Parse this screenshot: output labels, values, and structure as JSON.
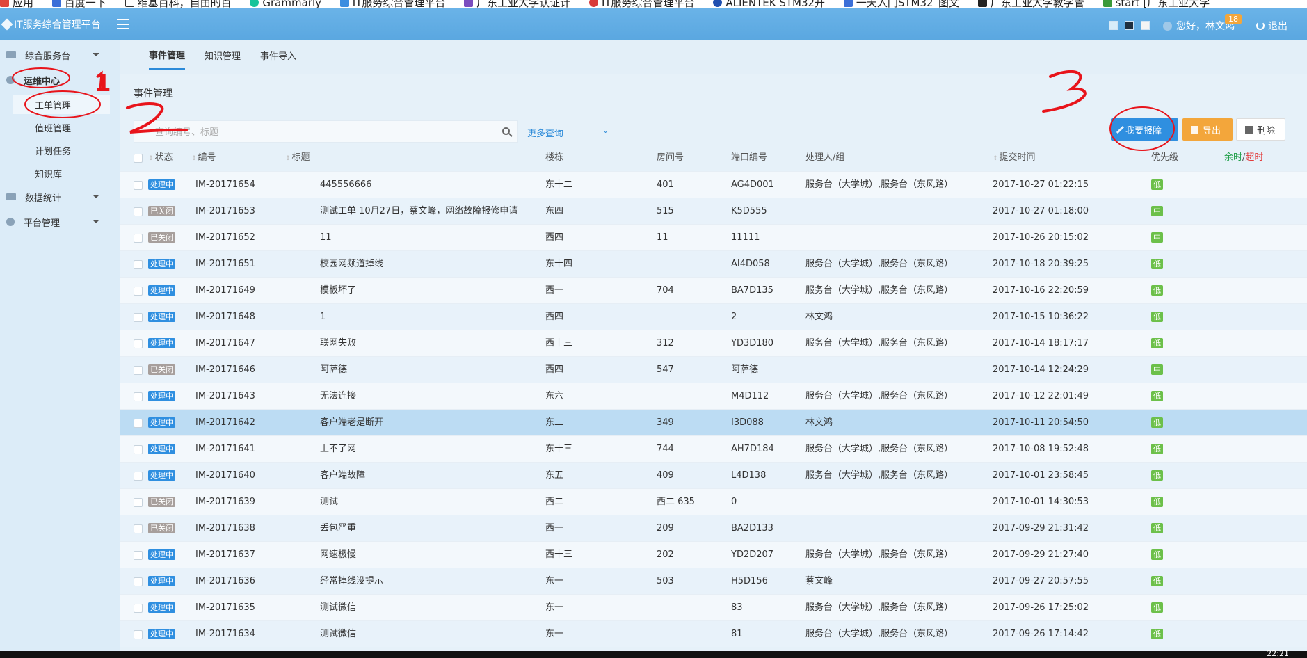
{
  "bookmarks": [
    {
      "label": "应用"
    },
    {
      "label": "百度一下"
    },
    {
      "label": "维基百科，自由的百"
    },
    {
      "label": "Grammarly"
    },
    {
      "label": "IT服务综合管理平台"
    },
    {
      "label": "广东工业大学认证计"
    },
    {
      "label": "IT服务综合管理平台"
    },
    {
      "label": "ALIENTEK STM32开"
    },
    {
      "label": "一天入门STM32_图文"
    },
    {
      "label": "广东工业大学教学管"
    },
    {
      "label": "start [广东工业大学"
    }
  ],
  "header": {
    "brand": "IT服务综合管理平台",
    "greeting": "您好，林文鸿",
    "badge": "18",
    "logout": "退出",
    "skin_colors": [
      "#d7ecf9",
      "#1e2f3f",
      "#f4f4f4"
    ]
  },
  "sidebar": {
    "groups": [
      {
        "label": "综合服务台",
        "icon": "desk-icon"
      },
      {
        "label": "运维中心",
        "icon": "gear-icon"
      },
      {
        "label": "数据统计",
        "icon": "chart-icon"
      },
      {
        "label": "平台管理",
        "icon": "settings-icon"
      }
    ],
    "subitems": [
      {
        "label": "工单管理"
      },
      {
        "label": "值班管理"
      },
      {
        "label": "计划任务"
      },
      {
        "label": "知识库"
      }
    ]
  },
  "tabs": [
    {
      "label": "事件管理"
    },
    {
      "label": "知识管理"
    },
    {
      "label": "事件导入"
    }
  ],
  "panel": {
    "title": "事件管理",
    "search_placeholder": "查询编号、标题",
    "more_query": "更多查询",
    "more_arrow": "⌄",
    "buttons": {
      "report": "我要报障",
      "export": "导出",
      "delete": "删除"
    }
  },
  "table": {
    "columns": {
      "status": "状态",
      "id": "编号",
      "title": "标题",
      "building": "楼栋",
      "room": "房间号",
      "port": "端口编号",
      "handler": "处理人/组",
      "time": "提交时间",
      "priority": "优先级",
      "remain": "余时",
      "sep": "/",
      "overtime": "超时"
    },
    "rows": [
      {
        "status": "处理中",
        "id": "IM-20171654",
        "title": "445556666",
        "building": "东十二",
        "room": "401",
        "port": "AG4D001",
        "handler": "服务台（大学城）,服务台（东风路）",
        "time": "2017-10-27 01:22:15",
        "priority": "低"
      },
      {
        "status": "已关闭",
        "id": "IM-20171653",
        "title": "测试工单 10月27日，蔡文峰，网络故障报修申请",
        "building": "东四",
        "room": "515",
        "port": "K5D555",
        "handler": "",
        "time": "2017-10-27 01:18:00",
        "priority": "中"
      },
      {
        "status": "已关闭",
        "id": "IM-20171652",
        "title": "11",
        "building": "西四",
        "room": "11",
        "port": "11111",
        "handler": "",
        "time": "2017-10-26 20:15:02",
        "priority": "中"
      },
      {
        "status": "处理中",
        "id": "IM-20171651",
        "title": "校园网频道掉线",
        "building": "东十四",
        "room": "",
        "port": "AI4D058",
        "handler": "服务台（大学城）,服务台（东风路）",
        "time": "2017-10-18 20:39:25",
        "priority": "低"
      },
      {
        "status": "处理中",
        "id": "IM-20171649",
        "title": "模板坏了",
        "building": "西一",
        "room": "704",
        "port": "BA7D135",
        "handler": "服务台（大学城）,服务台（东风路）",
        "time": "2017-10-16 22:20:59",
        "priority": "低"
      },
      {
        "status": "处理中",
        "id": "IM-20171648",
        "title": "1",
        "building": "西四",
        "room": "",
        "port": "2",
        "handler": "林文鸿",
        "time": "2017-10-15 10:36:22",
        "priority": "低"
      },
      {
        "status": "处理中",
        "id": "IM-20171647",
        "title": "联网失败",
        "building": "西十三",
        "room": "312",
        "port": "YD3D180",
        "handler": "服务台（大学城）,服务台（东风路）",
        "time": "2017-10-14 18:17:17",
        "priority": "低"
      },
      {
        "status": "已关闭",
        "id": "IM-20171646",
        "title": "阿萨德",
        "building": "西四",
        "room": "547",
        "port": "阿萨德",
        "handler": "",
        "time": "2017-10-14 12:24:29",
        "priority": "中"
      },
      {
        "status": "处理中",
        "id": "IM-20171643",
        "title": "无法连接",
        "building": "东六",
        "room": "",
        "port": "M4D112",
        "handler": "服务台（大学城）,服务台（东风路）",
        "time": "2017-10-12 22:01:49",
        "priority": "低"
      },
      {
        "status": "处理中",
        "id": "IM-20171642",
        "title": "客户端老是断开",
        "building": "东二",
        "room": "349",
        "port": "I3D088",
        "handler": "林文鸿",
        "time": "2017-10-11 20:54:50",
        "priority": "低"
      },
      {
        "status": "处理中",
        "id": "IM-20171641",
        "title": "上不了网",
        "building": "东十三",
        "room": "744",
        "port": "AH7D184",
        "handler": "服务台（大学城）,服务台（东风路）",
        "time": "2017-10-08 19:52:48",
        "priority": "低"
      },
      {
        "status": "处理中",
        "id": "IM-20171640",
        "title": "客户端故障",
        "building": "东五",
        "room": "409",
        "port": "L4D138",
        "handler": "服务台（大学城）,服务台（东风路）",
        "time": "2017-10-01 23:58:45",
        "priority": "低"
      },
      {
        "status": "已关闭",
        "id": "IM-20171639",
        "title": "测试",
        "building": "西二",
        "room": "西二 635",
        "port": "0",
        "handler": "",
        "time": "2017-10-01 14:30:53",
        "priority": "低"
      },
      {
        "status": "已关闭",
        "id": "IM-20171638",
        "title": "丢包严重",
        "building": "西一",
        "room": "209",
        "port": "BA2D133",
        "handler": "",
        "time": "2017-09-29 21:31:42",
        "priority": "低"
      },
      {
        "status": "处理中",
        "id": "IM-20171637",
        "title": "网速极慢",
        "building": "西十三",
        "room": "202",
        "port": "YD2D207",
        "handler": "服务台（大学城）,服务台（东风路）",
        "time": "2017-09-29 21:27:40",
        "priority": "低"
      },
      {
        "status": "处理中",
        "id": "IM-20171636",
        "title": "经常掉线没提示",
        "building": "东一",
        "room": "503",
        "port": "H5D156",
        "handler": "蔡文峰",
        "time": "2017-09-27 20:57:55",
        "priority": "低"
      },
      {
        "status": "处理中",
        "id": "IM-20171635",
        "title": "测试微信",
        "building": "东一",
        "room": "",
        "port": "83",
        "handler": "服务台（大学城）,服务台（东风路）",
        "time": "2017-09-26 17:25:02",
        "priority": "低"
      },
      {
        "status": "处理中",
        "id": "IM-20171634",
        "title": "测试微信",
        "building": "东一",
        "room": "",
        "port": "81",
        "handler": "服务台（大学城）,服务台（东风路）",
        "time": "2017-09-26 17:14:42",
        "priority": "低"
      }
    ]
  },
  "annotations": [
    {
      "label": "1"
    },
    {
      "label": "2"
    },
    {
      "label": "3"
    }
  ],
  "taskbar": {
    "clock": "22:21"
  },
  "colors": {
    "header": "#5aa7e0",
    "primary": "#2f8fe0",
    "export": "#f3a63b",
    "status_processing": "#2f8fe0",
    "status_closed": "#a79f9c",
    "priority": "#6cc04a",
    "annotation": "#e8141b"
  }
}
